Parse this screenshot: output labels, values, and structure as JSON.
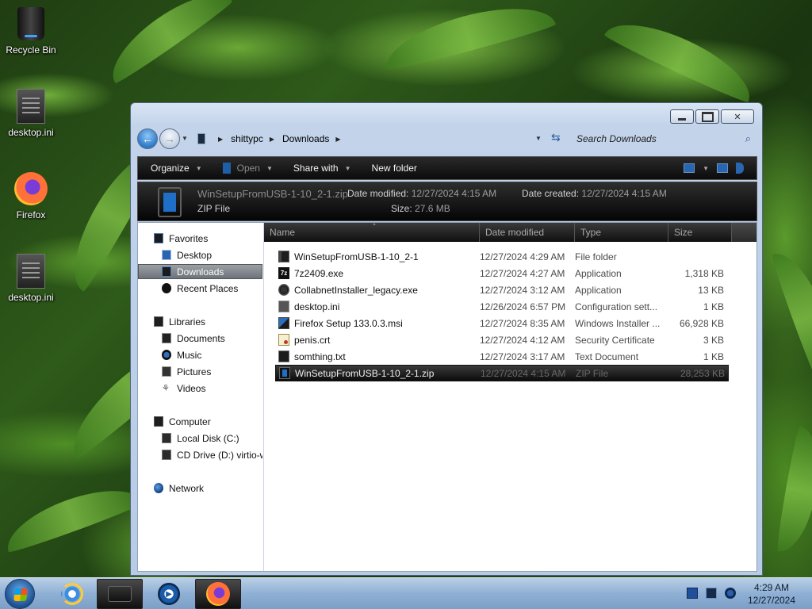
{
  "desktop": {
    "icons": [
      {
        "label": "Recycle Bin",
        "icon": "recycle-bin-icon"
      },
      {
        "label": "desktop.ini",
        "icon": "ini-file-icon"
      },
      {
        "label": "Firefox",
        "icon": "firefox-icon"
      },
      {
        "label": "desktop.ini",
        "icon": "ini-file-icon"
      }
    ]
  },
  "window": {
    "address": {
      "segments": [
        "shittypc",
        "Downloads"
      ]
    },
    "search_placeholder": "Search Downloads",
    "commands": {
      "organize": "Organize",
      "open": "Open",
      "share": "Share with",
      "new_folder": "New folder"
    },
    "details": {
      "filename": "WinSetupFromUSB-1-10_2-1.zip",
      "filetype": "ZIP File",
      "modified_label": "Date modified:",
      "modified_value": "12/27/2024 4:15 AM",
      "created_label": "Date created:",
      "created_value": "12/27/2024 4:15 AM",
      "size_label": "Size:",
      "size_value": "27.6 MB"
    },
    "nav": {
      "favorites": "Favorites",
      "desktop": "Desktop",
      "downloads": "Downloads",
      "recent": "Recent Places",
      "libraries": "Libraries",
      "documents": "Documents",
      "music": "Music",
      "pictures": "Pictures",
      "videos": "Videos",
      "computer": "Computer",
      "local_disk": "Local Disk (C:)",
      "cd_drive": "CD Drive (D:) virtio-w",
      "network": "Network"
    },
    "columns": {
      "name": "Name",
      "modified": "Date modified",
      "type": "Type",
      "size": "Size"
    },
    "files": [
      {
        "name": "WinSetupFromUSB-1-10_2-1",
        "modified": "12/27/2024 4:29 AM",
        "type": "File folder",
        "size": "",
        "icon": "folder-icon"
      },
      {
        "name": "7z2409.exe",
        "modified": "12/27/2024 4:27 AM",
        "type": "Application",
        "size": "1,318 KB",
        "icon": "7zip-icon"
      },
      {
        "name": "CollabnetInstaller_legacy.exe",
        "modified": "12/27/2024 3:12 AM",
        "type": "Application",
        "size": "13 KB",
        "icon": "installer-icon"
      },
      {
        "name": "desktop.ini",
        "modified": "12/26/2024 6:57 PM",
        "type": "Configuration sett...",
        "size": "1 KB",
        "icon": "ini-file-icon"
      },
      {
        "name": "Firefox Setup 133.0.3.msi",
        "modified": "12/27/2024 8:35 AM",
        "type": "Windows Installer ...",
        "size": "66,928 KB",
        "icon": "msi-icon"
      },
      {
        "name": "penis.crt",
        "modified": "12/27/2024 4:12 AM",
        "type": "Security Certificate",
        "size": "3 KB",
        "icon": "certificate-icon"
      },
      {
        "name": "somthing.txt",
        "modified": "12/27/2024 3:17 AM",
        "type": "Text Document",
        "size": "1 KB",
        "icon": "text-file-icon"
      },
      {
        "name": "WinSetupFromUSB-1-10_2-1.zip",
        "modified": "12/27/2024 4:15 AM",
        "type": "ZIP File",
        "size": "28,253 KB",
        "icon": "zip-file-icon",
        "selected": true
      }
    ]
  },
  "taskbar": {
    "time": "4:29 AM",
    "date": "12/27/2024"
  }
}
